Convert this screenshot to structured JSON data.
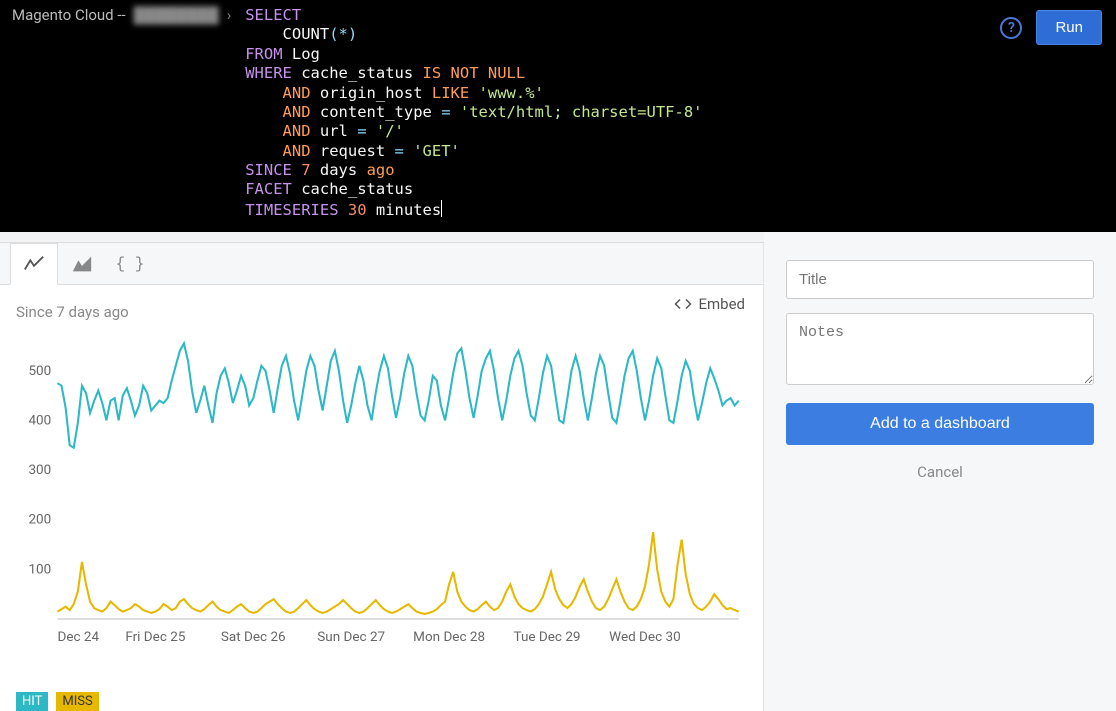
{
  "breadcrumb": {
    "item1": "Magento Cloud --",
    "item2_obscured": "████████"
  },
  "query": {
    "lines": [
      {
        "tokens": [
          {
            "t": "SELECT",
            "c": "kw"
          }
        ]
      },
      {
        "indent": 2,
        "tokens": [
          {
            "t": "COUNT",
            "c": "ident"
          },
          {
            "t": "(*)",
            "c": "punct"
          }
        ]
      },
      {
        "tokens": [
          {
            "t": "FROM",
            "c": "kw"
          },
          {
            "t": " Log",
            "c": "ident"
          }
        ]
      },
      {
        "tokens": [
          {
            "t": "WHERE",
            "c": "kw"
          },
          {
            "t": " cache_status ",
            "c": "ident"
          },
          {
            "t": "IS NOT ",
            "c": "kw2"
          },
          {
            "t": "NULL",
            "c": "null"
          }
        ]
      },
      {
        "indent": 2,
        "tokens": [
          {
            "t": "AND",
            "c": "kw2"
          },
          {
            "t": " origin_host ",
            "c": "ident"
          },
          {
            "t": "LIKE ",
            "c": "kw2"
          },
          {
            "t": "'www.%'",
            "c": "str"
          }
        ]
      },
      {
        "indent": 2,
        "tokens": [
          {
            "t": "AND",
            "c": "kw2"
          },
          {
            "t": " content_type ",
            "c": "ident"
          },
          {
            "t": "= ",
            "c": "punct"
          },
          {
            "t": "'text/html; charset=UTF-8'",
            "c": "str"
          }
        ]
      },
      {
        "indent": 2,
        "tokens": [
          {
            "t": "AND",
            "c": "kw2"
          },
          {
            "t": " url ",
            "c": "ident"
          },
          {
            "t": "= ",
            "c": "punct"
          },
          {
            "t": "'/'",
            "c": "str"
          }
        ]
      },
      {
        "indent": 2,
        "tokens": [
          {
            "t": "AND",
            "c": "kw2"
          },
          {
            "t": " request ",
            "c": "ident"
          },
          {
            "t": "= ",
            "c": "punct"
          },
          {
            "t": "'GET'",
            "c": "str"
          }
        ]
      },
      {
        "tokens": [
          {
            "t": "SINCE",
            "c": "kw"
          },
          {
            "t": " 7",
            "c": "num"
          },
          {
            "t": " days ",
            "c": "ident"
          },
          {
            "t": "ago",
            "c": "kw2"
          }
        ]
      },
      {
        "tokens": [
          {
            "t": "FACET",
            "c": "kw"
          },
          {
            "t": " cache_status",
            "c": "ident"
          }
        ]
      },
      {
        "tokens": [
          {
            "t": "TIMESERIES",
            "c": "kw"
          },
          {
            "t": " 30",
            "c": "num"
          },
          {
            "t": " minutes",
            "c": "ident"
          }
        ],
        "cursor": true
      }
    ]
  },
  "actions": {
    "help_glyph": "?",
    "run_label": "Run"
  },
  "result": {
    "embed_label": "Embed",
    "since_label": "Since 7 days ago",
    "legend": {
      "hit": "HIT",
      "miss": "MISS"
    },
    "x_labels": [
      "Dec 24",
      "Fri Dec 25",
      "Sat Dec 26",
      "Sun Dec 27",
      "Mon Dec 28",
      "Tue Dec 29",
      "Wed Dec 30"
    ],
    "y_ticks": [
      100,
      200,
      300,
      400,
      500
    ]
  },
  "sidebar": {
    "title_placeholder": "Title",
    "notes_placeholder": "Notes",
    "add_label": "Add to a dashboard",
    "cancel_label": "Cancel"
  },
  "chart_data": {
    "type": "line",
    "title": "",
    "xlabel": "",
    "ylabel": "",
    "ylim": [
      0,
      560
    ],
    "x": [
      0,
      1,
      2,
      3,
      4,
      5,
      6,
      7,
      8,
      9,
      10,
      11,
      12,
      13,
      14,
      15,
      16,
      17,
      18,
      19,
      20,
      21,
      22,
      23,
      24,
      25,
      26,
      27,
      28,
      29,
      30,
      31,
      32,
      33,
      34,
      35,
      36,
      37,
      38,
      39,
      40,
      41,
      42,
      43,
      44,
      45,
      46,
      47,
      48,
      49,
      50,
      51,
      52,
      53,
      54,
      55,
      56,
      57,
      58,
      59,
      60,
      61,
      62,
      63,
      64,
      65,
      66,
      67,
      68,
      69,
      70,
      71,
      72,
      73,
      74,
      75,
      76,
      77,
      78,
      79,
      80,
      81,
      82,
      83,
      84,
      85,
      86,
      87,
      88,
      89,
      90,
      91,
      92,
      93,
      94,
      95,
      96,
      97,
      98,
      99,
      100,
      101,
      102,
      103,
      104,
      105,
      106,
      107,
      108,
      109,
      110,
      111,
      112,
      113,
      114,
      115,
      116,
      117,
      118,
      119,
      120,
      121,
      122,
      123,
      124,
      125,
      126,
      127,
      128,
      129,
      130,
      131,
      132,
      133,
      134,
      135,
      136,
      137,
      138,
      139,
      140,
      141,
      142,
      143,
      144,
      145,
      146,
      147,
      148,
      149,
      150,
      151,
      152,
      153,
      154,
      155,
      156,
      157,
      158,
      159,
      160,
      161,
      162,
      163,
      164,
      165,
      166,
      167
    ],
    "x_tick_positions": [
      0,
      24,
      48,
      72,
      96,
      120,
      144
    ],
    "x_tick_labels": [
      "Dec 24",
      "Fri Dec 25",
      "Sat Dec 26",
      "Sun Dec 27",
      "Mon Dec 28",
      "Tue Dec 29",
      "Wed Dec 30"
    ],
    "series": [
      {
        "name": "HIT",
        "color": "#2db8c5",
        "values": [
          475,
          470,
          425,
          350,
          345,
          395,
          470,
          455,
          415,
          440,
          460,
          435,
          400,
          440,
          445,
          400,
          450,
          465,
          440,
          410,
          430,
          470,
          455,
          420,
          430,
          440,
          435,
          445,
          480,
          510,
          540,
          555,
          520,
          460,
          415,
          440,
          470,
          430,
          395,
          455,
          490,
          505,
          475,
          435,
          460,
          490,
          470,
          430,
          445,
          480,
          510,
          500,
          460,
          415,
          465,
          510,
          530,
          495,
          440,
          400,
          450,
          500,
          530,
          510,
          460,
          420,
          470,
          520,
          540,
          500,
          440,
          395,
          430,
          475,
          510,
          480,
          430,
          400,
          455,
          500,
          530,
          505,
          450,
          405,
          445,
          495,
          530,
          510,
          455,
          410,
          400,
          440,
          490,
          480,
          430,
          400,
          445,
          495,
          535,
          545,
          500,
          445,
          405,
          450,
          500,
          525,
          540,
          500,
          445,
          400,
          440,
          490,
          525,
          540,
          510,
          455,
          410,
          400,
          445,
          495,
          530,
          510,
          455,
          400,
          395,
          445,
          500,
          530,
          500,
          445,
          400,
          445,
          495,
          530,
          510,
          455,
          405,
          395,
          440,
          490,
          525,
          540,
          500,
          445,
          400,
          440,
          490,
          525,
          505,
          450,
          400,
          395,
          440,
          490,
          520,
          500,
          445,
          400,
          435,
          475,
          505,
          485,
          460,
          430,
          440,
          445,
          430,
          440
        ]
      },
      {
        "name": "MISS",
        "color": "#e6b800",
        "values": [
          15,
          20,
          25,
          18,
          30,
          55,
          115,
          70,
          35,
          22,
          18,
          15,
          22,
          35,
          28,
          20,
          15,
          18,
          22,
          30,
          25,
          18,
          15,
          12,
          15,
          20,
          30,
          25,
          18,
          22,
          35,
          40,
          30,
          22,
          18,
          15,
          20,
          28,
          35,
          25,
          18,
          15,
          12,
          18,
          25,
          30,
          22,
          15,
          12,
          15,
          22,
          30,
          35,
          40,
          30,
          22,
          15,
          12,
          15,
          22,
          30,
          38,
          28,
          20,
          15,
          12,
          15,
          20,
          25,
          30,
          38,
          30,
          22,
          15,
          12,
          15,
          22,
          30,
          38,
          28,
          20,
          15,
          12,
          15,
          20,
          25,
          30,
          22,
          15,
          12,
          10,
          12,
          15,
          20,
          28,
          35,
          70,
          95,
          55,
          35,
          25,
          18,
          15,
          20,
          28,
          35,
          25,
          18,
          22,
          35,
          55,
          70,
          45,
          30,
          22,
          18,
          15,
          20,
          30,
          45,
          70,
          95,
          60,
          40,
          28,
          22,
          30,
          45,
          65,
          80,
          55,
          35,
          22,
          18,
          25,
          40,
          60,
          80,
          55,
          35,
          22,
          18,
          25,
          40,
          65,
          110,
          175,
          100,
          55,
          35,
          25,
          40,
          110,
          160,
          90,
          50,
          30,
          22,
          18,
          25,
          35,
          50,
          40,
          28,
          20,
          22,
          18,
          15
        ]
      }
    ]
  }
}
